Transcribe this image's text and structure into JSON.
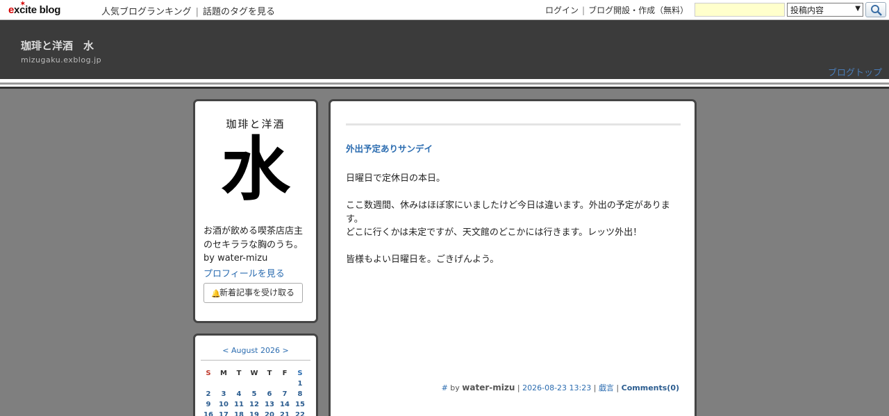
{
  "topbar": {
    "logo": "excite blog",
    "nav": [
      "人気ブログランキング",
      "話題のタグを見る"
    ],
    "links": [
      "ログイン",
      "ブログ開設・作成（無料）"
    ],
    "search": {
      "value": "",
      "select": "投稿内容",
      "button_icon": "search-icon"
    }
  },
  "header": {
    "title": "珈琲と洋酒　水",
    "url": "mizugaku.exblog.jp",
    "top_link": "ブログトップ"
  },
  "profile": {
    "logo_sub": "珈琲と洋酒",
    "logo_kanji": "水",
    "desc": "お酒が飲める喫茶店店主のセキララな胸のうち。",
    "by": "by water-mizu",
    "profile_link": "プロフィールを見る",
    "follow_button": "新着記事を受け取る"
  },
  "calendar": {
    "month_label": "< August 2026 >",
    "weekdays": [
      "S",
      "M",
      "T",
      "W",
      "T",
      "F",
      "S"
    ],
    "weeks": [
      [
        "",
        "",
        "",
        "",
        "",
        "",
        "1"
      ],
      [
        "2",
        "3",
        "4",
        "5",
        "6",
        "7",
        "8"
      ],
      [
        "9",
        "10",
        "11",
        "12",
        "13",
        "14",
        "15"
      ],
      [
        "16",
        "17",
        "18",
        "19",
        "20",
        "21",
        "22"
      ]
    ]
  },
  "post": {
    "title": "外出予定ありサンデイ",
    "paragraphs": [
      "日曜日で定休日の本日。",
      "ここ数週間、休みはほぼ家にいましたけど今日は違います。外出の予定があります。",
      "どこに行くかは未定ですが、天文館のどこかには行きます。レッツ外出！",
      "皆様もよい日曜日を。ごきげんよう。"
    ],
    "meta": {
      "hash": "#",
      "by": "by",
      "author": "water-mizu",
      "date": "2026-08-23 13:23",
      "category": "戯言",
      "comments": "Comments(0)"
    }
  }
}
